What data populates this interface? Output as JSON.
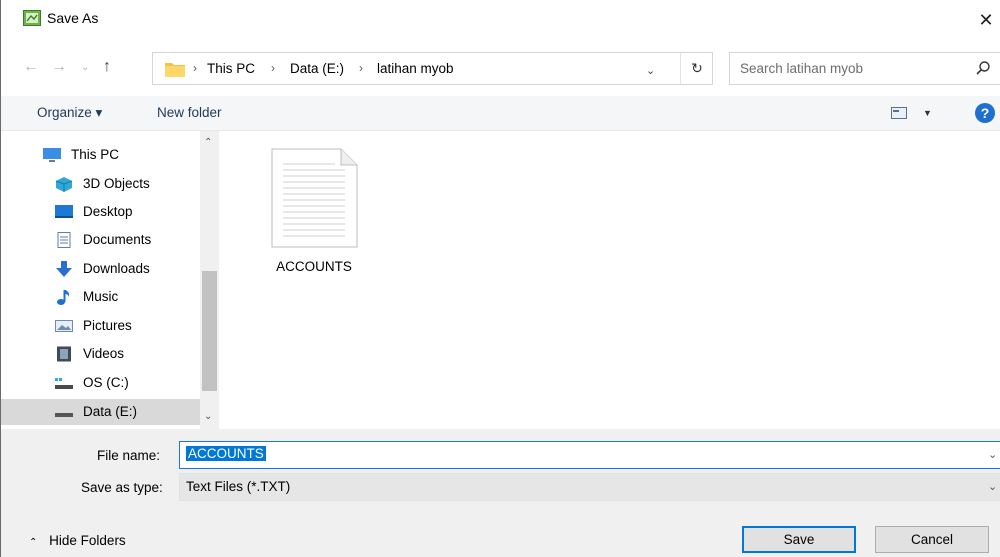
{
  "window": {
    "title": "Save As",
    "close_glyph": "✕"
  },
  "nav": {
    "back_glyph": "←",
    "forward_glyph": "→",
    "recent_glyph": "⌄",
    "up_glyph": "↑",
    "breadcrumb": [
      "This PC",
      "Data (E:)",
      "latihan myob"
    ],
    "separator": "›",
    "dropdown_glyph": "⌄",
    "refresh_glyph": "↻"
  },
  "search": {
    "placeholder": "Search latihan myob"
  },
  "toolbar": {
    "organize_label": "Organize ▾",
    "new_folder_label": "New folder",
    "view_drop_glyph": "▼",
    "help_glyph": "?"
  },
  "sidebar": {
    "items": [
      {
        "label": "This PC",
        "icon": "monitor-icon",
        "color": "#3b8ee6"
      },
      {
        "label": "3D Objects",
        "icon": "cube-icon",
        "color": "#2fa8d8"
      },
      {
        "label": "Desktop",
        "icon": "desktop-icon",
        "color": "#1e78d4"
      },
      {
        "label": "Documents",
        "icon": "document-icon",
        "color": "#5f7fa5"
      },
      {
        "label": "Downloads",
        "icon": "download-icon",
        "color": "#2a6fd0"
      },
      {
        "label": "Music",
        "icon": "music-icon",
        "color": "#1e6fd6"
      },
      {
        "label": "Pictures",
        "icon": "pictures-icon",
        "color": "#6b8bb0"
      },
      {
        "label": "Videos",
        "icon": "film-icon",
        "color": "#3f4a57"
      },
      {
        "label": "OS (C:)",
        "icon": "drive-icon",
        "color": "#2fa8d8"
      },
      {
        "label": "Data (E:)",
        "icon": "drive-icon",
        "color": "#555555",
        "selected": true
      }
    ],
    "scroll_up_glyph": "⌃",
    "scroll_down_glyph": "⌄"
  },
  "files": [
    {
      "name": "ACCOUNTS",
      "icon": "text-file-icon"
    }
  ],
  "form": {
    "file_name_label": "File name:",
    "file_name_value": "ACCOUNTS",
    "save_type_label": "Save as type:",
    "save_type_value": "Text Files (*.TXT)",
    "dropdown_glyph": "⌄"
  },
  "footer": {
    "hide_folders_label": "Hide Folders",
    "hide_folders_glyph": "⌃",
    "save_label": "Save",
    "cancel_label": "Cancel"
  },
  "colors": {
    "accent": "#0078d7",
    "toolbar_bg": "#f4f6f8",
    "bottom_bg": "#f0f0f0",
    "selected_bg": "#d9d9d9"
  }
}
